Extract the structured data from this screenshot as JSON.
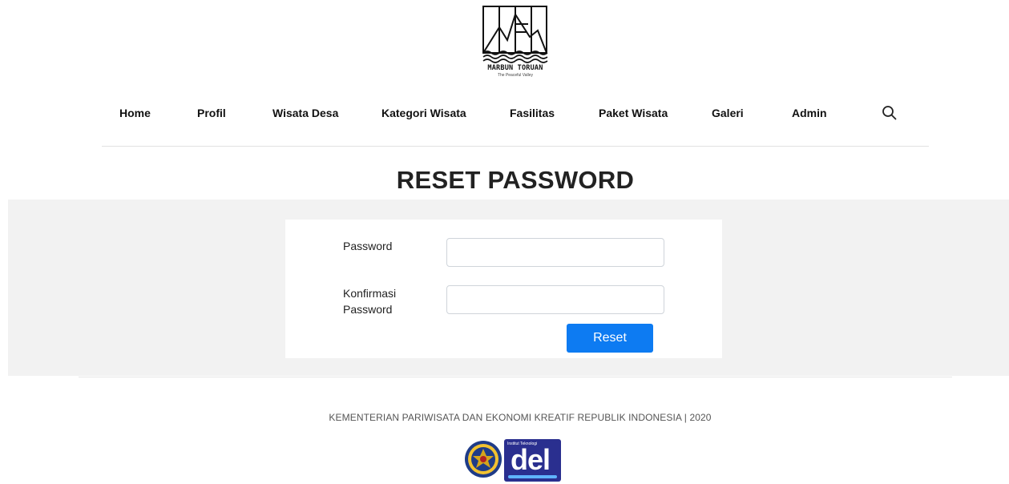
{
  "brand": {
    "name": "MARBUN TORUAN",
    "tagline": "The Peaceful Valley"
  },
  "nav": {
    "items": [
      {
        "label": "Home"
      },
      {
        "label": "Profil"
      },
      {
        "label": "Wisata Desa"
      },
      {
        "label": "Kategori Wisata"
      },
      {
        "label": "Fasilitas"
      },
      {
        "label": "Paket Wisata"
      },
      {
        "label": "Galeri"
      },
      {
        "label": "Admin"
      }
    ],
    "search_icon": "search-icon"
  },
  "page": {
    "title": "RESET PASSWORD"
  },
  "form": {
    "password_label": "Password",
    "password_value": "",
    "confirm_label_line1": "Konfirmasi",
    "confirm_label_line2": "Password",
    "confirm_value": "",
    "submit_label": "Reset"
  },
  "footer": {
    "text": "KEMENTERIAN PARIWISATA DAN EKONOMI KREATIF REPUBLIK INDONESIA | 2020",
    "partner_logo_text": "del",
    "partner_logo_caption": "Institut Teknologi"
  },
  "colors": {
    "accent": "#0d7bf2",
    "band": "#f2f2f2",
    "partner_logo_bg": "#2a2f8f"
  }
}
